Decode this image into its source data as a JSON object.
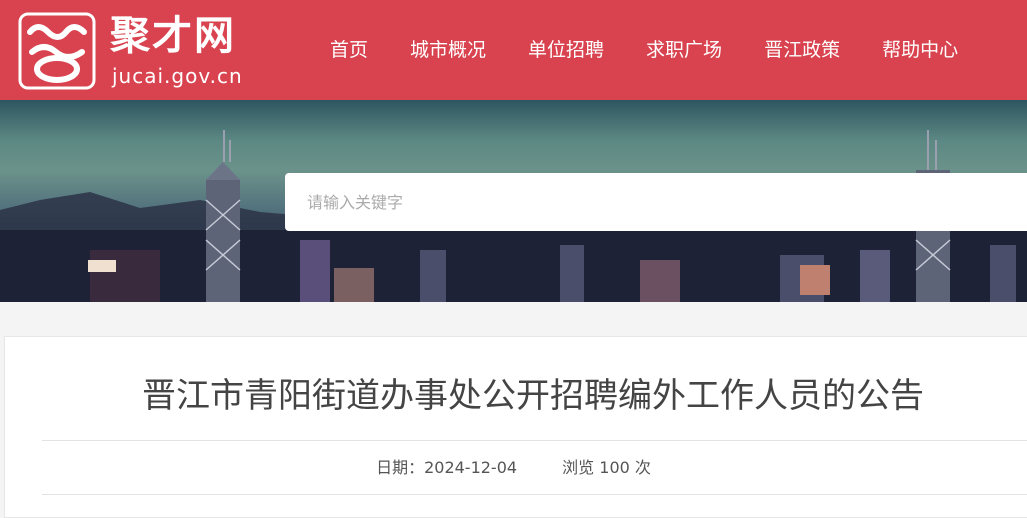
{
  "site": {
    "logo_name": "聚才网",
    "logo_domain": "jucai.gov.cn",
    "brand_color": "#d9434f"
  },
  "nav": {
    "items": [
      {
        "label": "首页"
      },
      {
        "label": "城市概况"
      },
      {
        "label": "单位招聘"
      },
      {
        "label": "求职广场"
      },
      {
        "label": "晋江政策"
      },
      {
        "label": "帮助中心"
      }
    ]
  },
  "search": {
    "placeholder": "请输入关键字",
    "value": ""
  },
  "article": {
    "title": "晋江市青阳街道办事处公开招聘编外工作人员的公告",
    "date_label": "日期：",
    "date": "2024-12-04",
    "views_label": "浏览",
    "views_count": "100",
    "views_unit": "次"
  }
}
